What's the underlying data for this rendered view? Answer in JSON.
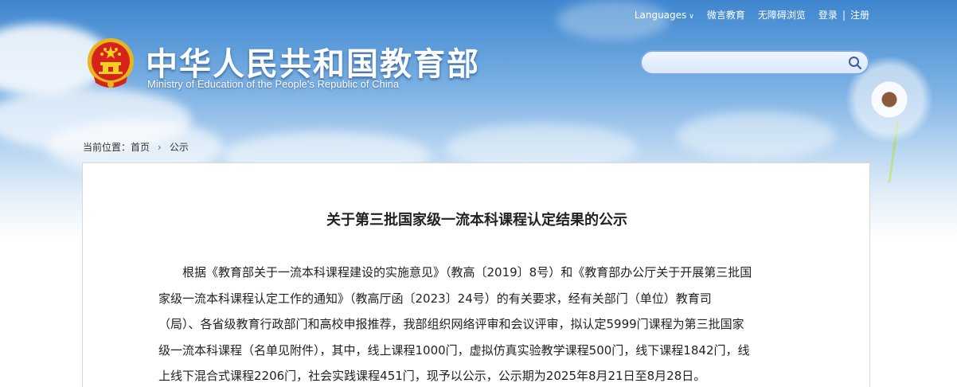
{
  "header": {
    "title_cn": "中华人民共和国教育部",
    "title_en": "Ministry of Education of the People's Republic of China",
    "emblem_icon": "national-emblem-icon"
  },
  "topnav": {
    "languages": "Languages",
    "weibo": "微言教育",
    "accessible": "无障碍浏览",
    "login": "登录",
    "separator": "|",
    "register": "注册"
  },
  "search": {
    "placeholder": "",
    "icon": "search-icon"
  },
  "breadcrumb": {
    "prefix": "当前位置：",
    "home": "首页",
    "current": "公示"
  },
  "article": {
    "title": "关于第三批国家级一流本科课程认定结果的公示",
    "lines": [
      "根据《教育部关于一流本科课程建设的实施意见》（教高〔2019〕8号）和《教育部办公厅关于开展第三批国",
      "家级一流本科课程认定工作的通知》（教高厅函〔2023〕24号）的有关要求，经有关部门（单位）教育司",
      "（局）、各省级教育行政部门和高校申报推荐，我部组织网络评审和会议评审，拟认定5999门课程为第三批国家",
      "级一流本科课程（名单见附件），其中，线上课程1000门，虚拟仿真实验教学课程500门，线下课程1842门，线",
      "上线下混合式课程2206门，社会实践课程451门，现予以公示，公示期为2025年8月21日至8月28日。"
    ]
  },
  "colors": {
    "sky_top": "#3f86cf",
    "text": "#222222",
    "search_border": "#7ea8e6"
  }
}
